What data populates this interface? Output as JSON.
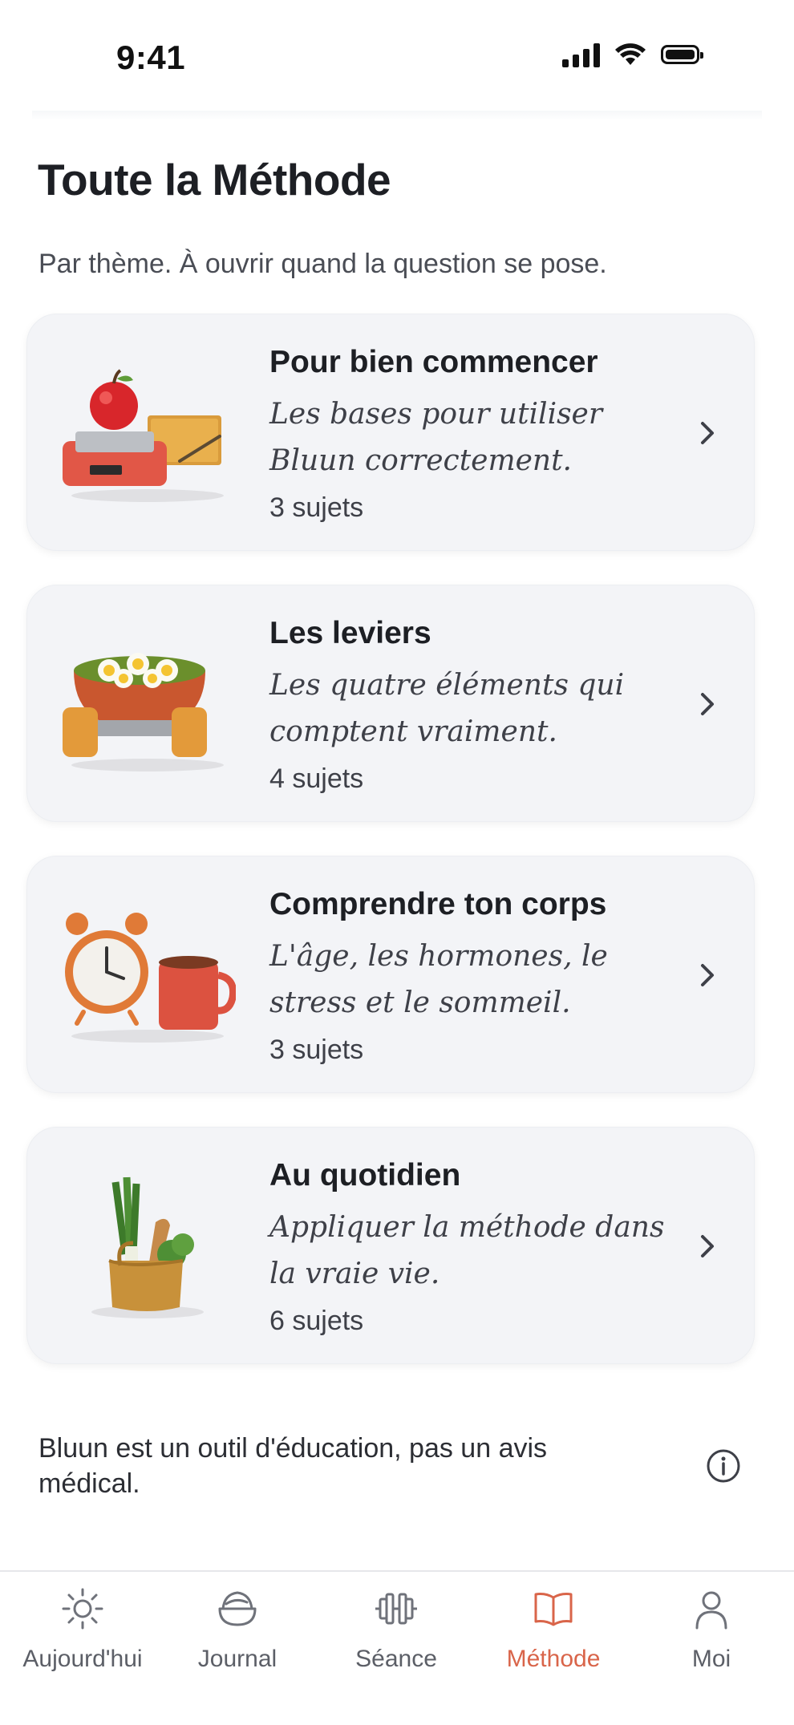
{
  "status_bar": {
    "time": "9:41"
  },
  "header": {
    "title": "Toute la Méthode",
    "subtitle": "Par thème. À ouvrir quand la question se pose."
  },
  "cards": [
    {
      "title": "Pour bien commencer",
      "description": "Les bases pour utiliser Bluun correctement.",
      "count": "3 sujets",
      "illustration": "scale-apple-notebook"
    },
    {
      "title": "Les leviers",
      "description": "Les quatre éléments qui comptent vraiment.",
      "count": "4 sujets",
      "illustration": "salad-bowl-dumbbell"
    },
    {
      "title": "Comprendre ton corps",
      "description": "L'âge, les hormones, le stress et le sommeil.",
      "count": "3 sujets",
      "illustration": "alarm-clock-mug"
    },
    {
      "title": "Au quotidien",
      "description": "Appliquer la méthode dans la vraie vie.",
      "count": "6 sujets",
      "illustration": "grocery-bag"
    }
  ],
  "disclaimer": "Bluun est un outil d'éducation, pas un avis médical.",
  "tabs": [
    {
      "label": "Aujourd'hui",
      "icon": "sun-icon",
      "active": false
    },
    {
      "label": "Journal",
      "icon": "bowl-icon",
      "active": false
    },
    {
      "label": "Séance",
      "icon": "dumbbell-icon",
      "active": false
    },
    {
      "label": "Méthode",
      "icon": "book-icon",
      "active": true
    },
    {
      "label": "Moi",
      "icon": "user-icon",
      "active": false
    }
  ],
  "colors": {
    "accent": "#d9654a",
    "card_background": "#f3f4f7",
    "text_primary": "#1d1f24",
    "text_muted": "#5c5f67"
  }
}
